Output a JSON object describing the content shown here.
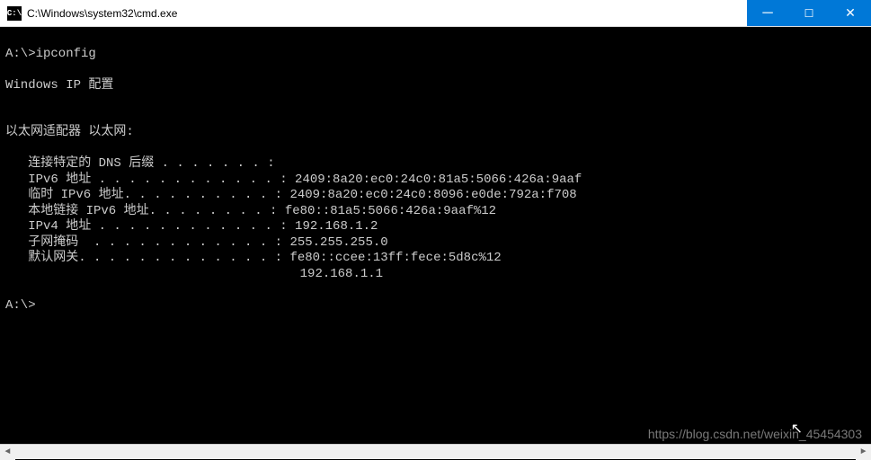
{
  "titlebar": {
    "icon_label": "C:\\",
    "title": "C:\\Windows\\system32\\cmd.exe"
  },
  "terminal": {
    "line1": "A:\\>ipconfig",
    "line2": "",
    "line3": "Windows IP 配置",
    "line4": "",
    "line5": "",
    "line6": "以太网适配器 以太网:",
    "line7": "",
    "line8": "   连接特定的 DNS 后缀 . . . . . . . :",
    "line9": "   IPv6 地址 . . . . . . . . . . . . : 2409:8a20:ec0:24c0:81a5:5066:426a:9aaf",
    "line10": "   临时 IPv6 地址. . . . . . . . . . : 2409:8a20:ec0:24c0:8096:e0de:792a:f708",
    "line11": "   本地链接 IPv6 地址. . . . . . . . : fe80::81a5:5066:426a:9aaf%12",
    "line12": "   IPv4 地址 . . . . . . . . . . . . : 192.168.1.2",
    "line13": "   子网掩码  . . . . . . . . . . . . : 255.255.255.0",
    "line14": "   默认网关. . . . . . . . . . . . . : fe80::ccee:13ff:fece:5d8c%12",
    "line15": "                                       192.168.1.1",
    "line16": "",
    "line17": "A:\\>"
  },
  "watermark": "https://blog.csdn.net/weixin_45454303"
}
